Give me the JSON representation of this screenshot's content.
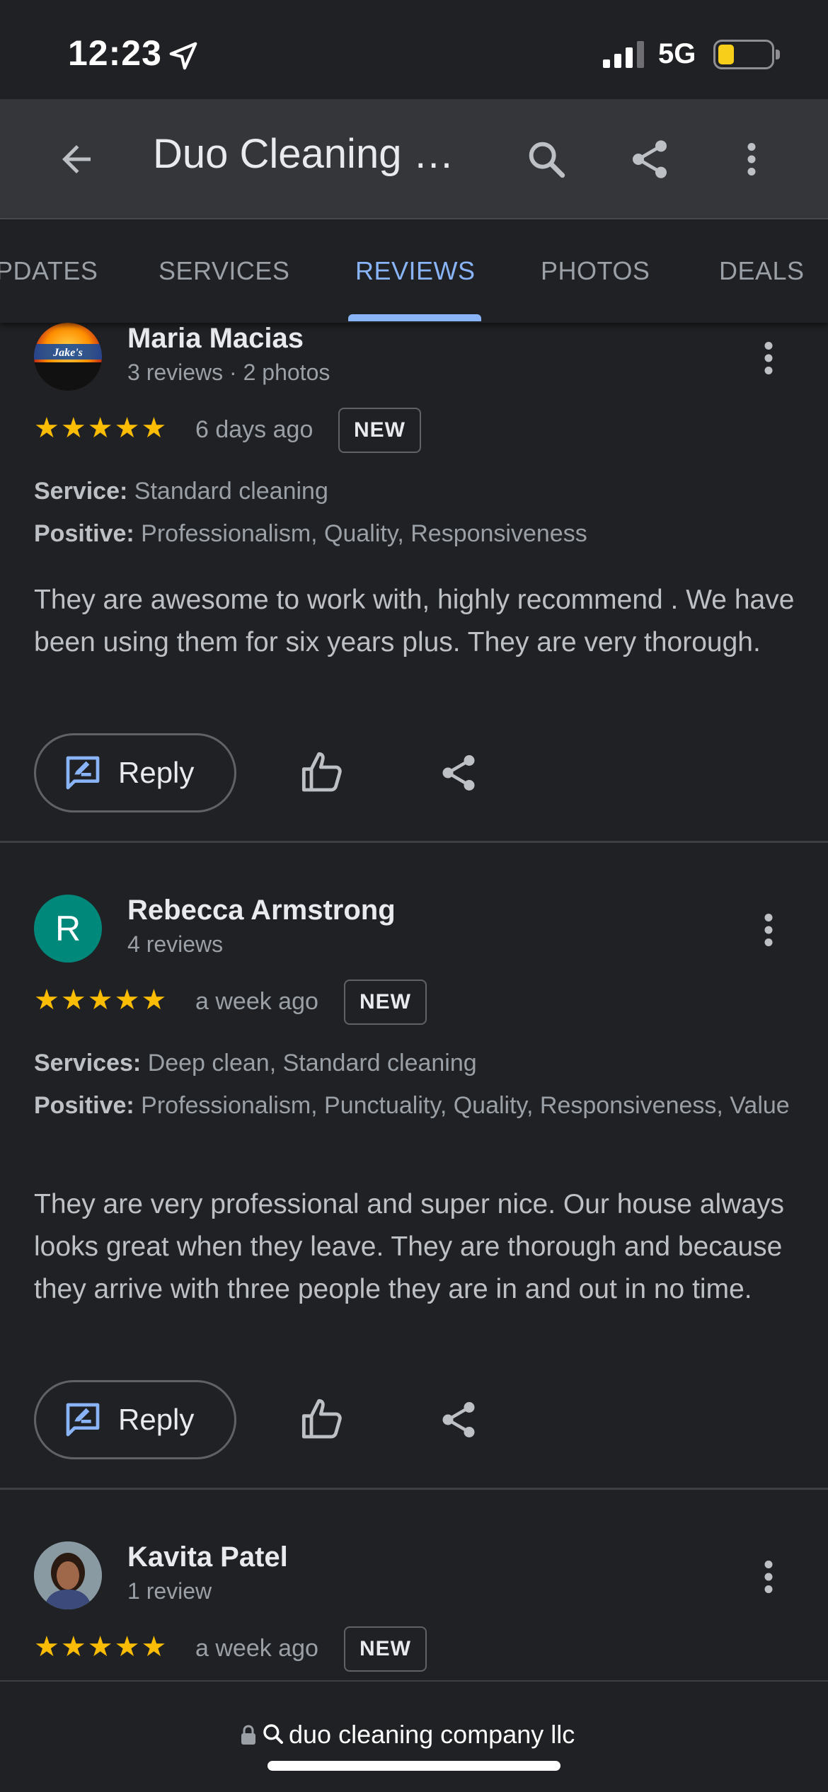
{
  "status_bar": {
    "time": "12:23",
    "network": "5G",
    "battery_level": 0.3
  },
  "app_bar": {
    "title": "Duo Cleaning …"
  },
  "tabs": [
    {
      "label": "PDATES",
      "active": false
    },
    {
      "label": "SERVICES",
      "active": false
    },
    {
      "label": "REVIEWS",
      "active": true
    },
    {
      "label": "PHOTOS",
      "active": false
    },
    {
      "label": "DEALS",
      "active": false
    }
  ],
  "reviews": [
    {
      "name": "Maria Macias",
      "meta": "3 reviews · 2 photos",
      "avatar_logo_text": "Jake's",
      "stars": "★★★★★",
      "rating": 5,
      "date": "6 days ago",
      "badge": "NEW",
      "attributes": [
        {
          "label": "Service:",
          "value": "Standard cleaning"
        },
        {
          "label": "Positive:",
          "value": "Professionalism, Quality, Responsiveness"
        }
      ],
      "text": "They are awesome to work with, highly recommend . We have been using them for six years plus. They are very thorough.",
      "reply_label": "Reply"
    },
    {
      "name": "Rebecca Armstrong",
      "meta": "4 reviews",
      "avatar_letter": "R",
      "stars": "★★★★★",
      "rating": 5,
      "date": "a week ago",
      "badge": "NEW",
      "attributes": [
        {
          "label": "Services:",
          "value": "Deep clean, Standard cleaning"
        },
        {
          "label": "Positive:",
          "value": "Professionalism, Punctuality, Quality, Responsiveness, Value"
        }
      ],
      "text": "They are very professional and super nice. Our house always looks great when they leave. They are thorough and because they arrive with three people they are in and out in no time.",
      "reply_label": "Reply"
    },
    {
      "name": "Kavita Patel",
      "meta": "1 review",
      "stars": "★★★★★",
      "rating": 5,
      "date": "a week ago",
      "badge": "NEW"
    }
  ],
  "url_bar": {
    "text": "duo cleaning company llc"
  },
  "colors": {
    "accent": "#8ab4f8",
    "star": "#fbbc04",
    "avatar_r": "#00897b",
    "background": "#202124",
    "app_bar": "#35363a"
  }
}
